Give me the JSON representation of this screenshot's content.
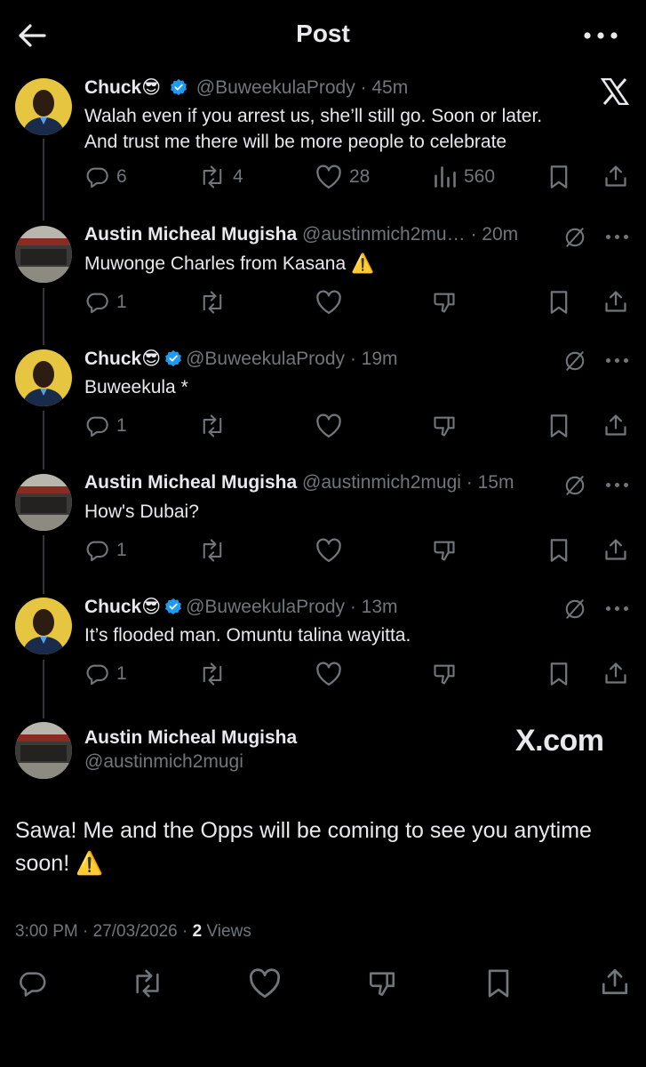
{
  "header": {
    "title": "Post"
  },
  "tweets": [
    {
      "name": "Chuck",
      "emoji": "😎",
      "verified": true,
      "handle": "@BuweekulaPrody",
      "time": "· 45m",
      "text_lines": [
        "Walah even if you arrest us, she’ll still go. Soon or later.",
        "And trust me there will be more people to celebrate"
      ],
      "replies": "6",
      "reposts": "4",
      "likes": "28",
      "views": "560"
    },
    {
      "name": "Austin Micheal Mugisha",
      "handle": "@austinmich2mu…",
      "time": "· 20m",
      "text": "Muwonge Charles from Kasana ⚠️",
      "replies": "1"
    },
    {
      "name": "Chuck",
      "emoji": "😎",
      "verified": true,
      "handle": "@BuweekulaPrody",
      "time": "· 19m",
      "text": "Buweekula *",
      "replies": "1"
    },
    {
      "name": "Austin Micheal Mugisha",
      "handle": "@austinmich2mugi",
      "time": "· 15m",
      "text": "How's Dubai?",
      "replies": "1"
    },
    {
      "name": "Chuck",
      "emoji": "😎",
      "verified": true,
      "handle": "@BuweekulaPrody",
      "time": "· 13m",
      "text": "It’s flooded man. Omuntu talina wayitta.",
      "replies": "1"
    }
  ],
  "main_post": {
    "name": "Austin Micheal Mugisha",
    "handle": "@austinmich2mugi",
    "watermark": "X.com",
    "text_lines": [
      "Sawa! Me and the Opps will be coming to see you anytime",
      "soon! ⚠️"
    ],
    "timestamp": "3:00 PM · 27/03/2026 · ",
    "views_count": "2",
    "views_label": " Views"
  },
  "colors": {
    "background": "#000000",
    "muted": "#71767b",
    "verified": "#1d9bf0",
    "text": "#e7e9ea"
  }
}
